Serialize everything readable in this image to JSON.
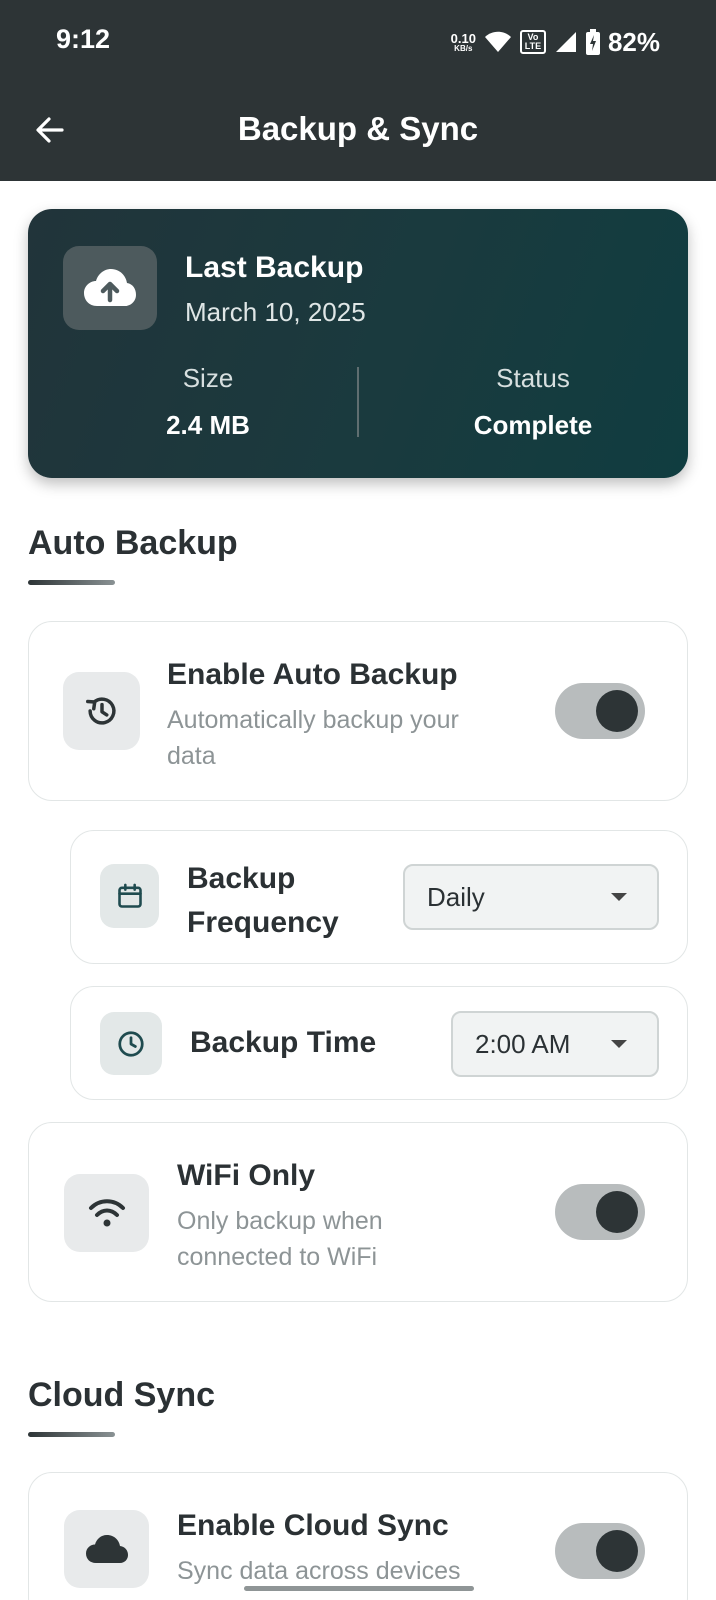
{
  "status_bar": {
    "time": "9:12",
    "net_speed": "0.10",
    "net_unit": "KB/s",
    "volte_top": "Vo",
    "volte_bottom": "LTE",
    "battery": "82%"
  },
  "header": {
    "title": "Backup & Sync",
    "back_icon": "arrow-left-icon"
  },
  "last_backup": {
    "label": "Last Backup",
    "date": "March 10, 2025",
    "size_label": "Size",
    "size_value": "2.4 MB",
    "status_label": "Status",
    "status_value": "Complete",
    "icon": "cloud-upload-icon"
  },
  "auto_backup": {
    "section_title": "Auto Backup",
    "enable": {
      "title": "Enable Auto Backup",
      "subtitle_line1": "Automatically backup your",
      "subtitle_line2": "data",
      "enabled": true,
      "icon": "history-icon"
    },
    "frequency": {
      "title_line1": "Backup",
      "title_line2": "Frequency",
      "value": "Daily",
      "icon": "calendar-icon"
    },
    "time": {
      "title": "Backup Time",
      "value": "2:00 AM",
      "icon": "clock-icon"
    },
    "wifi_only": {
      "title": "WiFi Only",
      "subtitle_line1": "Only backup when",
      "subtitle_line2": "connected to WiFi",
      "enabled": true,
      "icon": "wifi-icon"
    }
  },
  "cloud_sync": {
    "section_title": "Cloud Sync",
    "enable": {
      "title": "Enable Cloud Sync",
      "subtitle": "Sync data across devices",
      "enabled": true,
      "icon": "cloud-icon"
    }
  },
  "colors": {
    "header_bg": "#2d3436",
    "hero_start": "#21343a",
    "hero_end": "#103d40",
    "toggle_track": "#b8bcbd",
    "toggle_knob": "#2d3436"
  }
}
